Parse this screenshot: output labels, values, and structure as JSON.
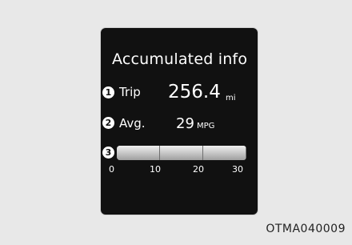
{
  "title": "Accumulated info",
  "markers": {
    "trip": "1",
    "avg": "2",
    "bar": "3"
  },
  "rows": {
    "trip": {
      "label": "Trip",
      "value": "256.4",
      "unit": "mi"
    },
    "avg": {
      "label": "Avg.",
      "value": "29",
      "unit": "MPG"
    }
  },
  "scale": {
    "ticks": [
      "0",
      "10",
      "20",
      "30"
    ]
  },
  "caption": "OTMA040009"
}
